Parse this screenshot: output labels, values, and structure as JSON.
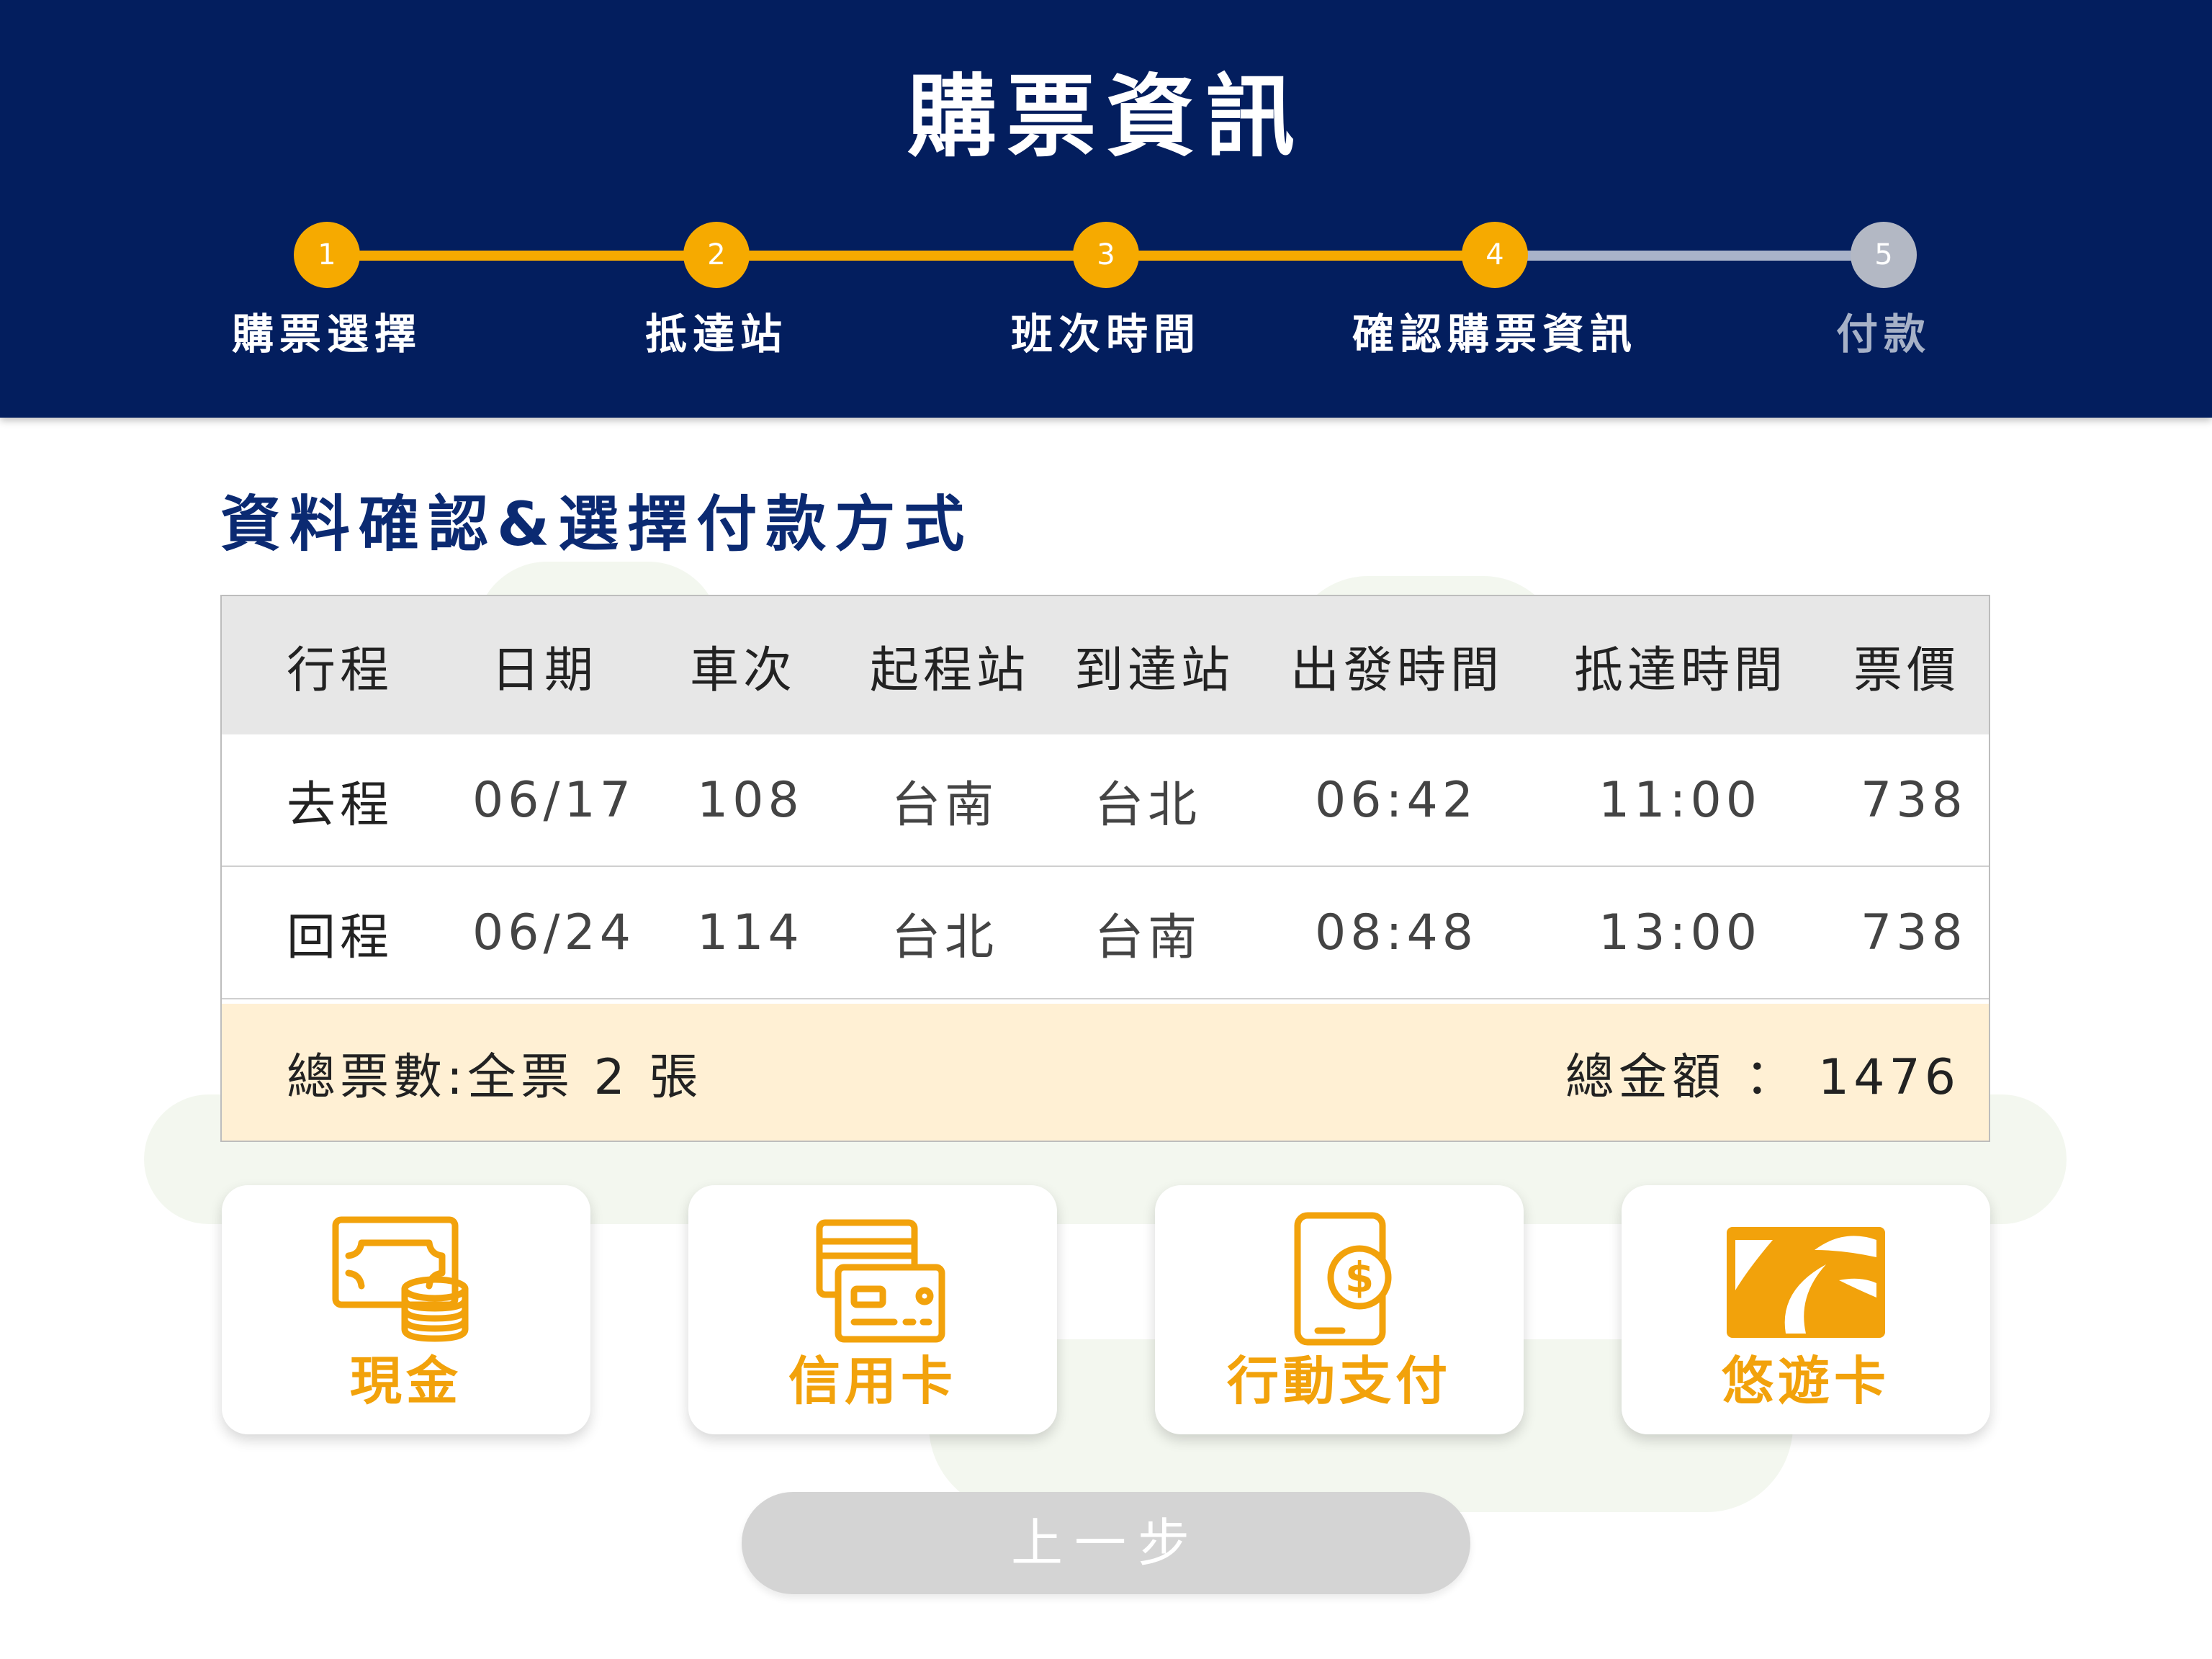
{
  "header": {
    "title": "購票資訊",
    "steps": [
      {
        "number": "1",
        "label": "購票選擇",
        "state": "done"
      },
      {
        "number": "2",
        "label": "抵達站",
        "state": "done"
      },
      {
        "number": "3",
        "label": "班次時間",
        "state": "done"
      },
      {
        "number": "4",
        "label": "確認購票資訊",
        "state": "current"
      },
      {
        "number": "5",
        "label": "付款",
        "state": "pending"
      }
    ]
  },
  "section_title": "資料確認&選擇付款方式",
  "table": {
    "headers": [
      "行程",
      "日期",
      "車次",
      "起程站",
      "到達站",
      "出發時間",
      "抵達時間",
      "票價"
    ],
    "rows": [
      [
        "去程",
        "06/17",
        "108",
        "台南",
        "台北",
        "06:42",
        "11:00",
        "738"
      ],
      [
        "回程",
        "06/24",
        "114",
        "台北",
        "台南",
        "08:48",
        "13:00",
        "738"
      ]
    ],
    "summary": {
      "ticket_count": "總票數:全票 2 張",
      "total_amount": "總金額 ： 1476"
    }
  },
  "payment_methods": [
    {
      "label": "現金",
      "icon": "cash-coins-icon"
    },
    {
      "label": "信用卡",
      "icon": "credit-card-icon"
    },
    {
      "label": "行動支付",
      "icon": "mobile-payment-icon"
    },
    {
      "label": "悠遊卡",
      "icon": "easycard-icon"
    }
  ],
  "back_button": "上一步",
  "colors": {
    "header_bg": "#031e5e",
    "accent": "#f6aa00",
    "pending_step": "#b3b8c4",
    "summary_bg": "#fff0d4",
    "payment_label": "#f2a20b"
  }
}
